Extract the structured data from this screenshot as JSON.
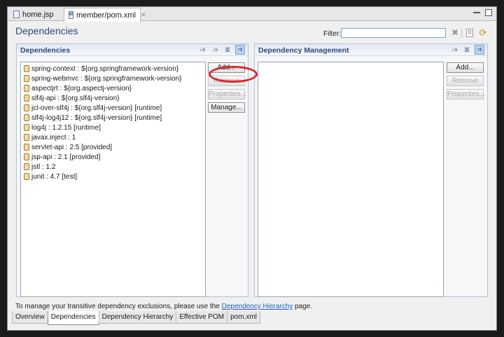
{
  "editor_tabs": [
    {
      "label": "home.jsp",
      "icon": "jsp-file-icon",
      "active": false
    },
    {
      "label": "member/pom.xml",
      "icon": "maven-pom-icon",
      "icon_glyph": "M",
      "active": true
    }
  ],
  "header": {
    "title": "Dependencies",
    "filter_label": "Filter:",
    "filter_value": ""
  },
  "dependencies": {
    "title": "Dependencies",
    "items": [
      "spring-context : ${org.springframework-version}",
      "spring-webmvc : ${org.springframework-version}",
      "aspectjrt : ${org.aspectj-version}",
      "slf4j-api : ${org.slf4j-version}",
      "jcl-over-slf4j : ${org.slf4j-version} [runtime]",
      "slf4j-log4j12 : ${org.slf4j-version} [runtime]",
      "log4j : 1.2.15 [runtime]",
      "javax.inject : 1",
      "servlet-api : 2.5 [provided]",
      "jsp-api : 2.1 [provided]",
      "jstl : 1.2",
      "junit : 4.7 [test]"
    ],
    "buttons": {
      "add": "Add...",
      "remove": "Remove",
      "properties": "Properties...",
      "manage": "Manage..."
    }
  },
  "management": {
    "title": "Dependency Management",
    "items": [],
    "buttons": {
      "add": "Add...",
      "remove": "Remove",
      "properties": "Properties..."
    }
  },
  "hint": {
    "before": "To manage your transitive dependency exclusions, please use the ",
    "link": "Dependency Hierarchy",
    "after": " page."
  },
  "bottom_tabs": [
    {
      "label": "Overview",
      "active": false
    },
    {
      "label": "Dependencies",
      "active": true
    },
    {
      "label": "Dependency Hierarchy",
      "active": false
    },
    {
      "label": "Effective POM",
      "active": false
    },
    {
      "label": "pom.xml",
      "active": false
    }
  ],
  "colors": {
    "title_blue": "#2c4a7a",
    "link_blue": "#2160c4",
    "highlight_red": "#d9262e"
  }
}
